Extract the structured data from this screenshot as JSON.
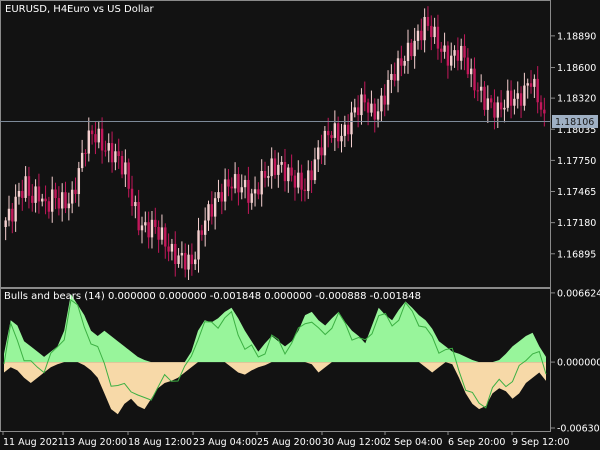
{
  "header": {
    "symbol_label": "EURUSD, H4:",
    "symbol_description": "Euro vs US Dollar"
  },
  "indicator": {
    "label": "Bulls and bears (14) 0.000000 0.000000 -0.001848 0.000000 -0.000888 -0.001848"
  },
  "colors": {
    "background": "#121212",
    "bull_candle": "#f5d0d0",
    "bear_candle": "#c2185b",
    "bull_area": "#98f59b",
    "bear_area": "#f7d9a8",
    "signal_line": "#3cb043",
    "price_tag_bg": "#9fb0c4"
  },
  "chart_data": [
    {
      "type": "candlestick",
      "title": "EURUSD, H4: Euro vs US Dollar",
      "ylim": [
        1.166,
        1.192
      ],
      "y_ticks": [
        "1.18890",
        "1.18600",
        "1.18320",
        "1.18035",
        "1.17750",
        "1.17465",
        "1.17180",
        "1.16895"
      ],
      "current_price": "1.18106",
      "x_ticks": [
        "11 Aug 2021",
        "13 Aug 20:00",
        "18 Aug 12:00",
        "23 Aug 04:00",
        "25 Aug 20:00",
        "30 Aug 12:00",
        "2 Sep 04:00",
        "6 Sep 20:00",
        "9 Sep 12:00"
      ],
      "close_path": [
        1.172,
        1.1728,
        1.1745,
        1.1752,
        1.174,
        1.1745,
        1.1732,
        1.1742,
        1.1738,
        1.1736,
        1.174,
        1.1765,
        1.179,
        1.18,
        1.1795,
        1.1785,
        1.1782,
        1.1776,
        1.1765,
        1.1738,
        1.1718,
        1.1712,
        1.1715,
        1.171,
        1.17,
        1.169,
        1.1686,
        1.1684,
        1.168,
        1.1702,
        1.1722,
        1.1732,
        1.1742,
        1.175,
        1.1755,
        1.1752,
        1.175,
        1.174,
        1.1752,
        1.1762,
        1.1768,
        1.177,
        1.1765,
        1.176,
        1.1755,
        1.175,
        1.1765,
        1.1782,
        1.1795,
        1.1802,
        1.1798,
        1.18,
        1.1815,
        1.1825,
        1.183,
        1.1818,
        1.182,
        1.1835,
        1.1852,
        1.186,
        1.187,
        1.1878,
        1.1888,
        1.19,
        1.1895,
        1.1882,
        1.1872,
        1.1868,
        1.1875,
        1.187,
        1.185,
        1.184,
        1.183,
        1.1825,
        1.182,
        1.1828,
        1.1832,
        1.183,
        1.1838,
        1.185,
        1.1832,
        1.1818
      ]
    },
    {
      "type": "area",
      "title": "Bulls and bears (14)",
      "ylim": [
        -0.0065,
        0.0069
      ],
      "y_ticks": [
        "0.006624",
        "0.000000",
        "-0.006308"
      ],
      "series": [
        {
          "name": "Bulls",
          "values": [
            0.0008,
            0.004,
            0.0035,
            0.002,
            0.0015,
            0.001,
            0.0005,
            0.001,
            0.0015,
            0.003,
            0.0065,
            0.0055,
            0.0045,
            0.003,
            0.0025,
            0.003,
            0.0025,
            0.002,
            0.0015,
            0.001,
            0.0005,
            0.0002,
            0.0,
            0.0,
            0.0,
            0.0,
            0.0,
            0.0,
            0.001,
            0.003,
            0.004,
            0.0038,
            0.0042,
            0.0048,
            0.0052,
            0.0042,
            0.003,
            0.002,
            0.001,
            0.0018,
            0.0025,
            0.002,
            0.0015,
            0.002,
            0.003,
            0.0045,
            0.0048,
            0.004,
            0.0035,
            0.0042,
            0.0048,
            0.0038,
            0.003,
            0.0025,
            0.0018,
            0.0035,
            0.0052,
            0.0045,
            0.004,
            0.005,
            0.0058,
            0.0052,
            0.0045,
            0.004,
            0.0032,
            0.002,
            0.0015,
            0.001,
            0.0008,
            0.0005,
            0.0002,
            0.0,
            0.0,
            0.0,
            0.0002,
            0.0008,
            0.0015,
            0.002,
            0.0025,
            0.0028,
            0.0015,
            0.0005
          ]
        },
        {
          "name": "Bears",
          "values": [
            -0.001,
            -0.0005,
            -0.0008,
            -0.0015,
            -0.002,
            -0.0015,
            -0.001,
            -0.0005,
            -0.0002,
            0.0,
            0.0,
            0.0,
            -0.0003,
            -0.0008,
            -0.0015,
            -0.003,
            -0.0045,
            -0.005,
            -0.004,
            -0.0035,
            -0.0042,
            -0.0045,
            -0.0035,
            -0.0025,
            -0.002,
            -0.0018,
            -0.0015,
            -0.001,
            -0.0005,
            0.0,
            0.0,
            0.0,
            0.0,
            0.0,
            -0.0005,
            -0.001,
            -0.0012,
            -0.0008,
            -0.0005,
            -0.0003,
            0.0,
            0.0,
            0.0,
            0.0,
            0.0,
            0.0,
            -0.0002,
            -0.001,
            -0.0005,
            0.0,
            0.0,
            0.0,
            0.0,
            0.0,
            0.0,
            0.0,
            0.0,
            0.0,
            0.0,
            0.0,
            0.0,
            0.0,
            0.0,
            -0.0005,
            -0.001,
            -0.0005,
            0.0,
            -0.0002,
            -0.0015,
            -0.003,
            -0.004,
            -0.0045,
            -0.0042,
            -0.003,
            -0.0025,
            -0.0028,
            -0.0035,
            -0.003,
            -0.002,
            -0.0015,
            -0.001,
            -0.0018
          ]
        }
      ]
    }
  ]
}
